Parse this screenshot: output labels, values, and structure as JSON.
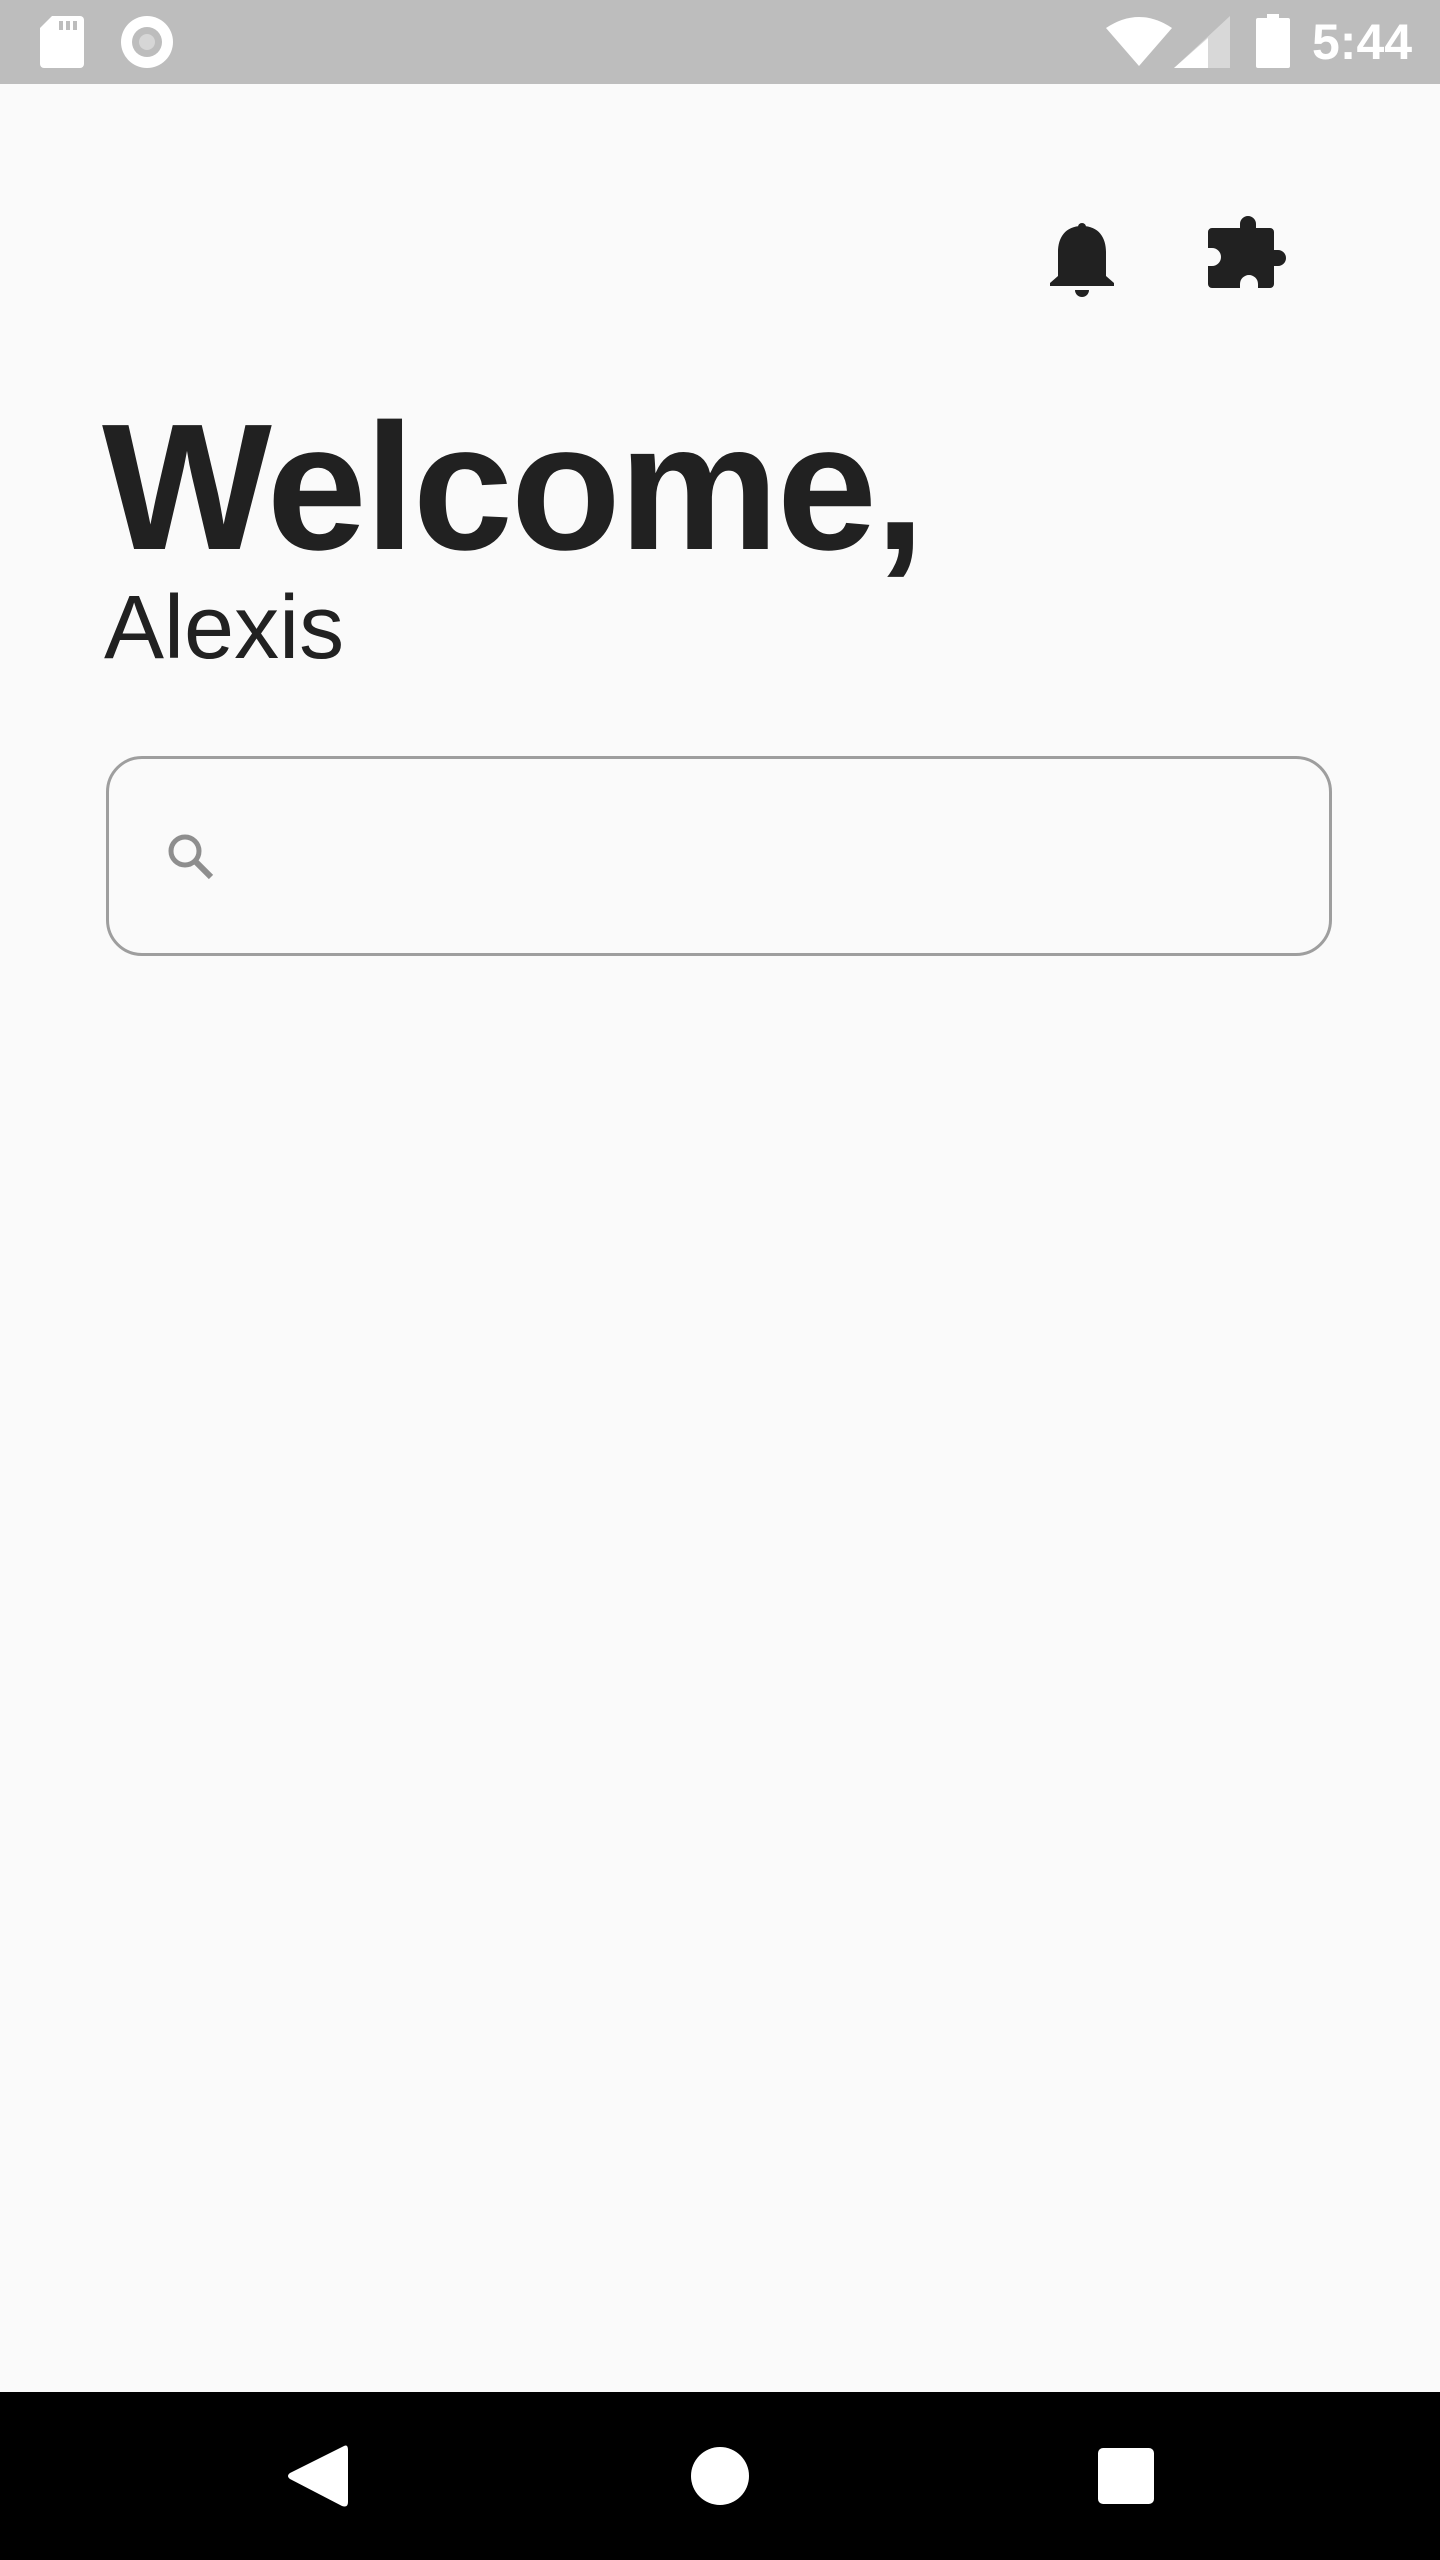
{
  "status_bar": {
    "time": "5:44",
    "icons": [
      "sd-card-icon",
      "circle-icon",
      "wifi-icon",
      "signal-icon",
      "battery-icon"
    ]
  },
  "header": {
    "actions": [
      "bell-icon",
      "extension-puzzle-icon"
    ]
  },
  "main": {
    "greeting": "Welcome,",
    "user_name": "Alexis",
    "search": {
      "placeholder": "",
      "value": ""
    }
  },
  "nav_bar": {
    "buttons": [
      "back-icon",
      "home-icon",
      "recents-icon"
    ]
  },
  "colors": {
    "status_bar_bg": "#bdbdbd",
    "background": "#fafafa",
    "text_primary": "#212121",
    "search_border": "#9e9e9e",
    "nav_bar_bg": "#000000"
  }
}
